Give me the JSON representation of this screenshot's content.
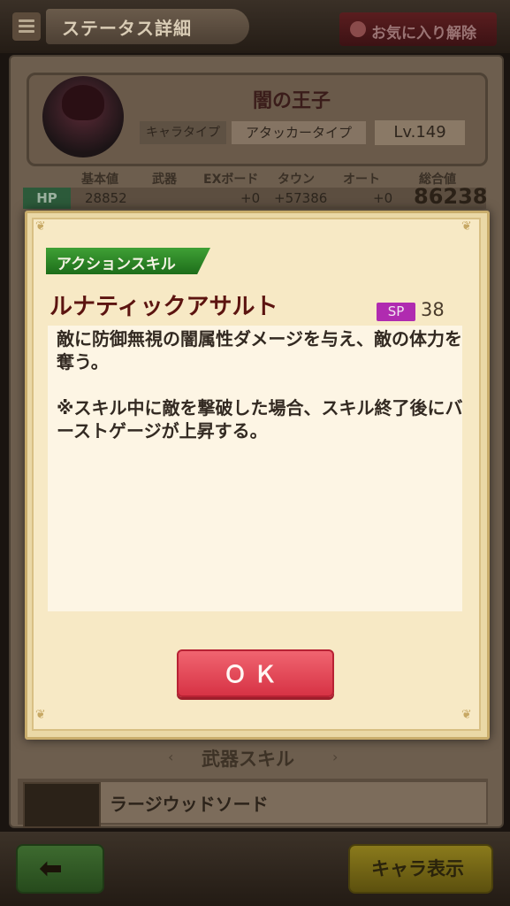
{
  "header": {
    "title": "ステータス詳細",
    "favorite_label": "お気に入り解除"
  },
  "character": {
    "name": "闇の王子",
    "type_label": "キャラタイプ",
    "type_value": "アタッカータイプ",
    "level": "Lv.149"
  },
  "stats": {
    "headers": [
      "基本値",
      "武器",
      "EXボード",
      "タウン",
      "オート",
      "総合値"
    ],
    "hp": {
      "label": "HP",
      "base": "28852",
      "ex_board": "+0",
      "town": "+57386",
      "auto": "+0",
      "total": "86238"
    }
  },
  "weapon_section": {
    "title": "武器スキル",
    "weapon_name": "ラージウッドソード"
  },
  "modal": {
    "tag": "アクションスキル",
    "skill_name": "ルナティックアサルト",
    "sp_label": "SP",
    "sp_value": "38",
    "description": [
      "敵に防御無視の闇属性ダメージを与え、敵の体力を奪う。",
      "※スキル中に敵を撃破した場合、スキル終了後にバーストゲージが上昇する。"
    ],
    "ok_label": "ＯＫ"
  },
  "footer": {
    "chara_view_label": "キャラ表示"
  }
}
